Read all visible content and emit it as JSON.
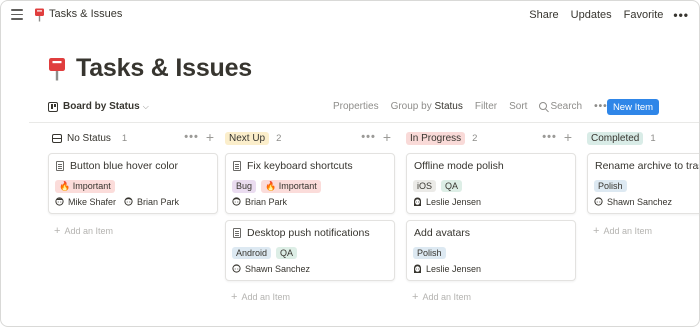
{
  "topbar": {
    "breadcrumb": "Tasks & Issues",
    "actions": [
      "Share",
      "Updates",
      "Favorite"
    ],
    "more": "•••"
  },
  "page": {
    "title": "Tasks & Issues",
    "icon": "pushpin-icon"
  },
  "viewbar": {
    "view_label": "Board by Status",
    "properties": "Properties",
    "group_by": "Group by",
    "group_by_value": "Status",
    "filter": "Filter",
    "sort": "Sort",
    "search": "Search",
    "more": "•••",
    "new_item": "New Item"
  },
  "colors": {
    "accent": "#2f86e8",
    "status_no": "transparent",
    "status_next": "#fbeecb",
    "status_progress": "#f9dad8",
    "status_completed": "#d9ece7",
    "tag_important": "#fbdcda",
    "tag_bug": "#eadcf0",
    "tag_ios": "#ebeae7",
    "tag_qa": "#ddeee6",
    "tag_android": "#dde9f2",
    "tag_polish": "#dde9f2"
  },
  "columns": [
    {
      "status": "No Status",
      "count": "1",
      "add_label": "Add an Item",
      "cards": [
        {
          "title": "Button blue hover color",
          "doc": true,
          "tags": [
            "🔥 Important"
          ],
          "people": [
            "Mike Shafer",
            "Brian Park"
          ]
        }
      ]
    },
    {
      "status": "Next Up",
      "count": "2",
      "add_label": "Add an Item",
      "cards": [
        {
          "title": "Fix keyboard shortcuts",
          "doc": true,
          "tags": [
            "Bug",
            "🔥 Important"
          ],
          "people": [
            "Brian Park"
          ]
        },
        {
          "title": "Desktop push notifications",
          "doc": true,
          "tags": [
            "Android",
            "QA"
          ],
          "people": [
            "Shawn Sanchez"
          ]
        }
      ]
    },
    {
      "status": "In Progress",
      "count": "2",
      "add_label": "Add an Item",
      "cards": [
        {
          "title": "Offline mode polish",
          "doc": false,
          "tags": [
            "iOS",
            "QA"
          ],
          "people": [
            "Leslie Jensen"
          ]
        },
        {
          "title": "Add avatars",
          "doc": false,
          "tags": [
            "Polish"
          ],
          "people": [
            "Leslie Jensen"
          ]
        }
      ]
    },
    {
      "status": "Completed",
      "count": "1",
      "add_label": "Add an Item",
      "cards": [
        {
          "title": "Rename archive to trash",
          "doc": false,
          "tags": [
            "Polish"
          ],
          "people": [
            "Shawn Sanchez"
          ]
        }
      ]
    }
  ],
  "col_actions": {
    "more": "•••",
    "add": "+"
  }
}
